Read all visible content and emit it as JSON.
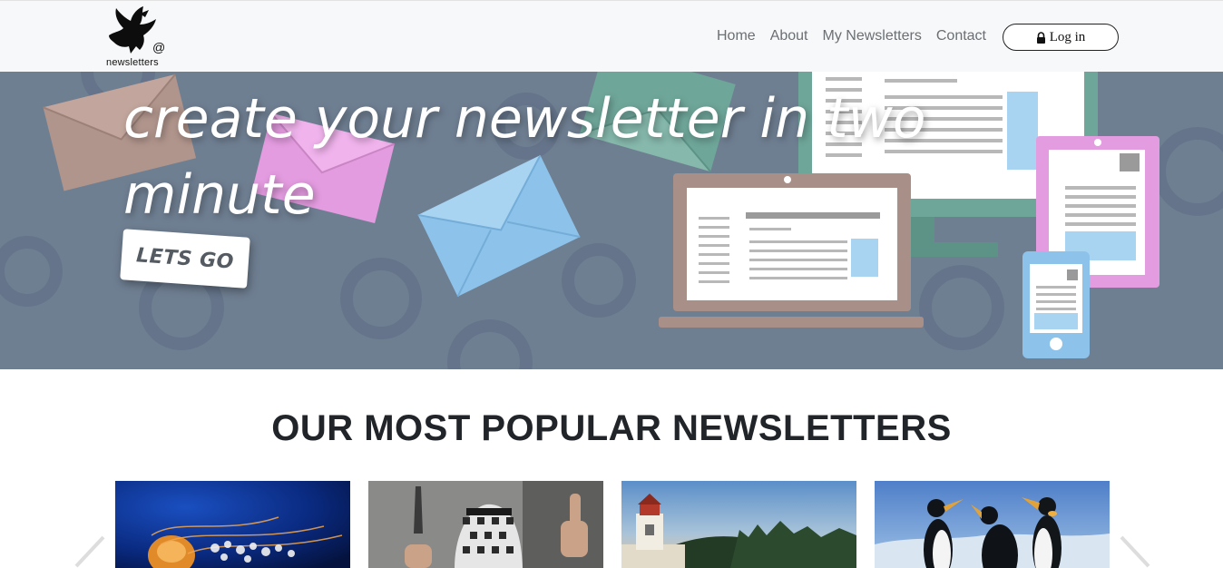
{
  "brand": {
    "logo_text": "newsletters"
  },
  "nav": {
    "links": [
      {
        "label": "Home"
      },
      {
        "label": "About"
      },
      {
        "label": "My Newsletters"
      },
      {
        "label": "Contact"
      }
    ],
    "login_label": "Log in",
    "login_icon": "lock-icon"
  },
  "hero": {
    "title": "create your newsletter in two minute",
    "cta_label": "LETS GO"
  },
  "popular": {
    "heading": "OUR MOST POPULAR NEWSLETTERS",
    "cards": [
      {
        "image": "jellyfish"
      },
      {
        "image": "masked-figure-with-knife"
      },
      {
        "image": "lighthouse"
      },
      {
        "image": "penguins"
      }
    ],
    "prev_icon": "chevron-left-icon",
    "next_icon": "chevron-right-icon"
  },
  "colors": {
    "hero_bg": "#6f7f92",
    "navbar_bg": "#f7f8f9",
    "heading": "#212529",
    "nav_link": "#6b6f73"
  }
}
